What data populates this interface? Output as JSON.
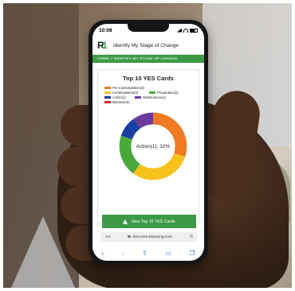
{
  "status_bar": {
    "time": "10:08"
  },
  "app": {
    "title": "Identify My Stage of Change",
    "breadcrumb": "HOME  >  IDENTIFY MY STAGE OF CHANGE"
  },
  "chart_data": {
    "type": "pie",
    "title": "Top 10 YES Cards",
    "center_label": "Action(1): 10%",
    "categories": [
      "Pre Contemplation(3)",
      "Contemplation(3)",
      "Preparation(2)",
      "Action(1)",
      "Maintenance(1)",
      "Behavior(0)"
    ],
    "values": [
      3,
      3,
      2,
      1,
      1,
      0
    ],
    "colors": [
      "#f07b22",
      "#f6c21b",
      "#4aa83b",
      "#1a3fa3",
      "#6a3b9a",
      "#d62828"
    ],
    "legend_position": "top"
  },
  "cta": {
    "label": "View Top 10 YES Cards",
    "icon": "warning-icon"
  },
  "browser": {
    "aa": "AA",
    "url": "discoverr1learning.com",
    "reload_icon": "reload-icon"
  },
  "safari_toolbar": {
    "back": "‹",
    "forward": "›",
    "share": "⇪",
    "bookmarks": "▭",
    "tabs": "❐"
  }
}
